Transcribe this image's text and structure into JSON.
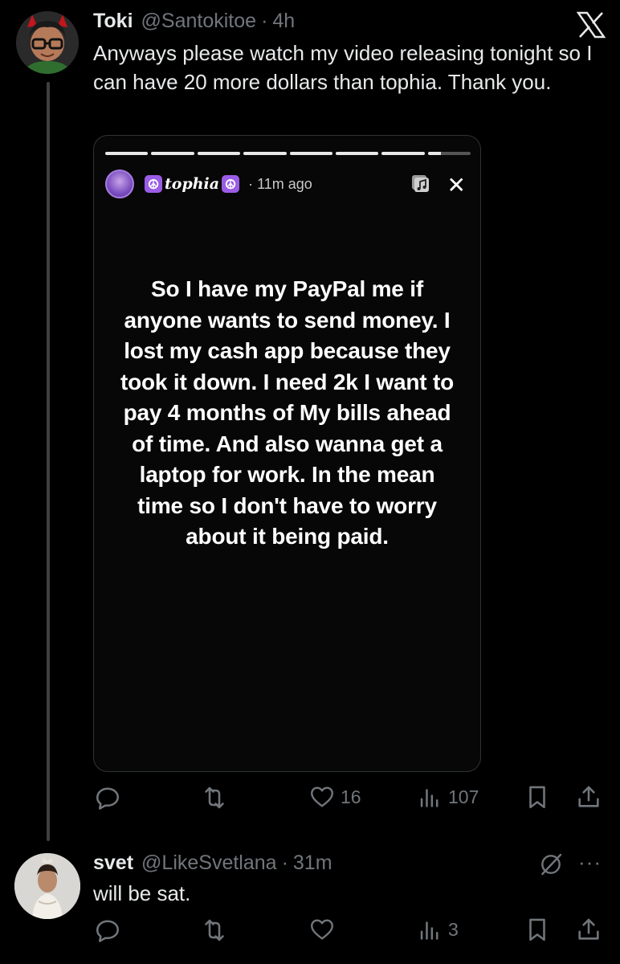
{
  "thread": {
    "tweet": {
      "name": "Toki",
      "handle": "@Santokitoe",
      "separator": "·",
      "time": "4h",
      "text": "Anyways please watch my video releasing tonight so I can have 20 more dollars than tophia. Thank you.",
      "story": {
        "username": "tophia",
        "time": "· 11m ago",
        "close": "✕",
        "text": "So I have my PayPal me if anyone wants to send money. I lost my cash app because they took it down. I need 2k I want to pay 4 months of My bills ahead of time. And also wanna get a laptop for work. In the mean time so I don't have to worry about it being paid."
      },
      "actions": {
        "likes": "16",
        "views": "107"
      }
    },
    "reply": {
      "name": "svet",
      "handle": "@LikeSvetlana",
      "separator": "·",
      "time": "31m",
      "text": "will be sat.",
      "more": "···",
      "actions": {
        "views": "3"
      }
    }
  },
  "colors": {
    "background": "#000000",
    "text": "#e7e9ea",
    "muted": "#71767b",
    "peace_badge": "#9b5de5"
  },
  "icons": [
    "x-logo-icon",
    "reply-icon",
    "retweet-icon",
    "like-icon",
    "views-icon",
    "bookmark-icon",
    "share-icon",
    "peace-icon",
    "music-icon",
    "grok-icon",
    "more-icon"
  ]
}
